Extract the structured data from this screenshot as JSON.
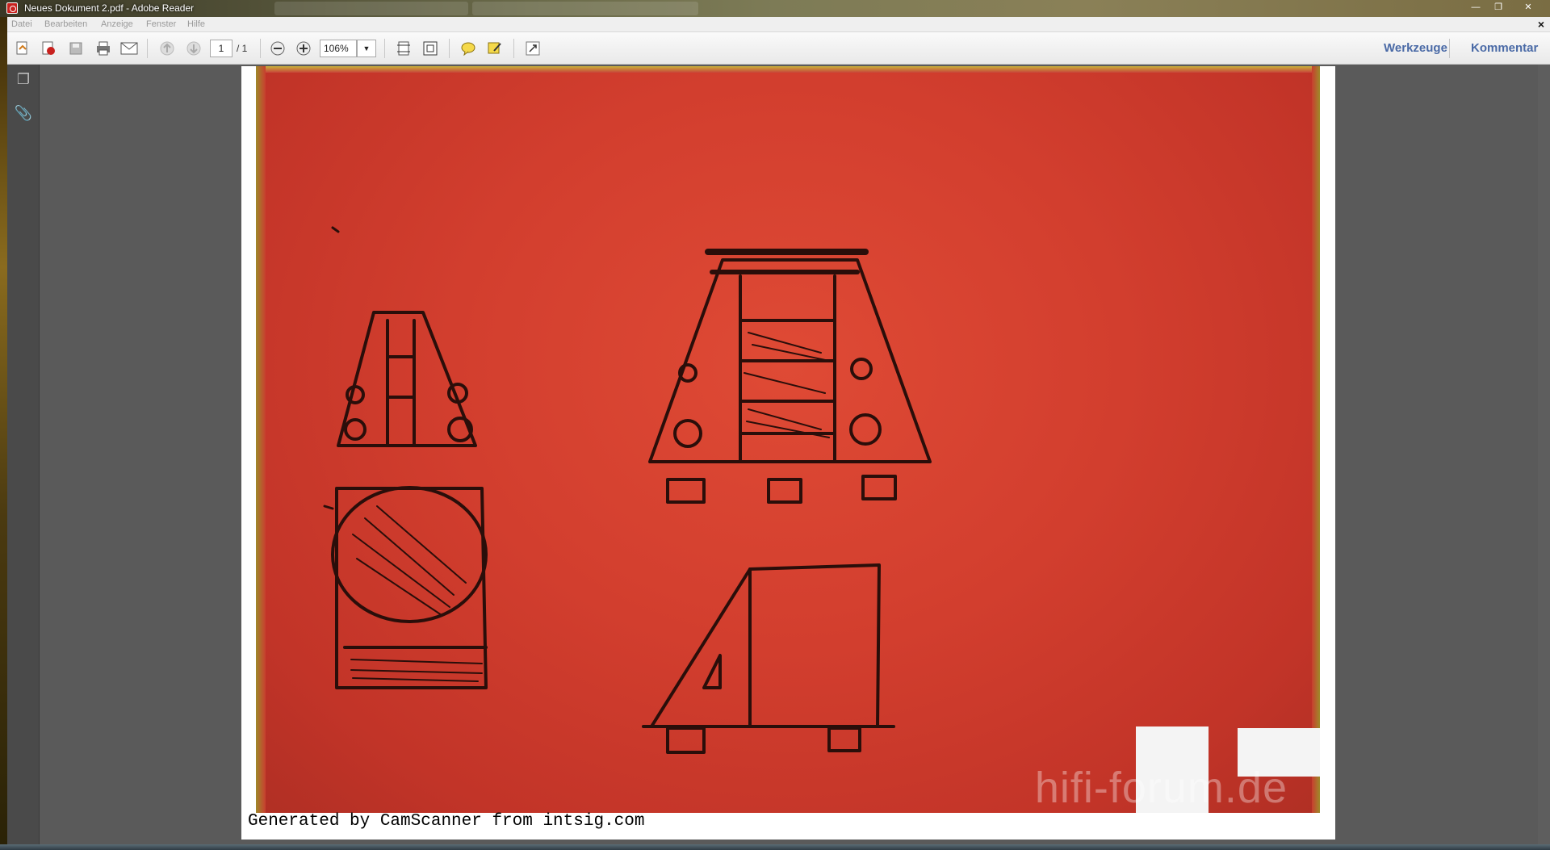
{
  "window": {
    "title": "Neues Dokument 2.pdf - Adobe Reader",
    "controls": [
      "minimize-icon",
      "restore-icon",
      "close-icon"
    ]
  },
  "menu": {
    "items": [
      "Datei",
      "Bearbeiten",
      "Anzeige",
      "Fenster",
      "Hilfe"
    ]
  },
  "toolbar": {
    "page_current": "1",
    "page_total": "/ 1",
    "zoom": "106%",
    "tools_label": "Werkzeuge",
    "comment_label": "Kommentar"
  },
  "document": {
    "caption": "Generated by CamScanner from intsig.com"
  },
  "watermark": "hifi-forum.de",
  "colors": {
    "paper_red": "#d23e2e",
    "panel_gray": "#5a5a5a",
    "accent_blue": "#4a6aa6"
  }
}
